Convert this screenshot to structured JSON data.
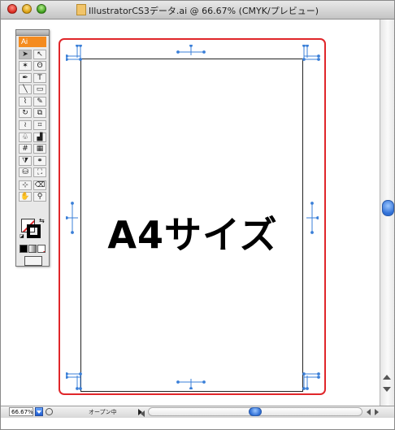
{
  "window": {
    "title": "IllustratorCS3データ.ai @ 66.67% (CMYK/プレビュー)"
  },
  "toolbox": {
    "logo": "Ai",
    "tools": [
      {
        "icon": "selection-arrow",
        "glyph": "➤",
        "selected": true
      },
      {
        "icon": "direct-selection-arrow",
        "glyph": "↖"
      },
      {
        "icon": "magic-wand",
        "glyph": "✶"
      },
      {
        "icon": "lasso",
        "glyph": "ʘ"
      },
      {
        "icon": "pen",
        "glyph": "✒"
      },
      {
        "icon": "type",
        "glyph": "T"
      },
      {
        "icon": "line-segment",
        "glyph": "╲"
      },
      {
        "icon": "rectangle",
        "glyph": "▭"
      },
      {
        "icon": "paintbrush",
        "glyph": "⌇"
      },
      {
        "icon": "pencil",
        "glyph": "✎"
      },
      {
        "icon": "rotate",
        "glyph": "↻"
      },
      {
        "icon": "scale",
        "glyph": "⧉"
      },
      {
        "icon": "warp",
        "glyph": "≀"
      },
      {
        "icon": "free-transform",
        "glyph": "⌗"
      },
      {
        "icon": "symbol-sprayer",
        "glyph": "♧"
      },
      {
        "icon": "column-graph",
        "glyph": "▟"
      },
      {
        "icon": "mesh",
        "glyph": "#"
      },
      {
        "icon": "gradient",
        "glyph": "▦"
      },
      {
        "icon": "eyedropper",
        "glyph": "⧩"
      },
      {
        "icon": "blend",
        "glyph": "⚭"
      },
      {
        "icon": "live-paint-bucket",
        "glyph": "⛁"
      },
      {
        "icon": "live-paint-selection",
        "glyph": "⛶"
      },
      {
        "icon": "crop-area",
        "glyph": "⊹"
      },
      {
        "icon": "eraser",
        "glyph": "⌫"
      },
      {
        "icon": "hand",
        "glyph": "✋"
      },
      {
        "icon": "zoom",
        "glyph": "⚲"
      }
    ]
  },
  "document": {
    "main_text": "A4サイズ"
  },
  "status_bar": {
    "zoom": "66.67%",
    "status_text": "オープン中"
  },
  "colors": {
    "artboard_border": "#e0262a",
    "crop_mark_blue": "#3a7fd8",
    "accent_blue": "#2f6fd6",
    "logo_orange": "#f48b1f"
  }
}
